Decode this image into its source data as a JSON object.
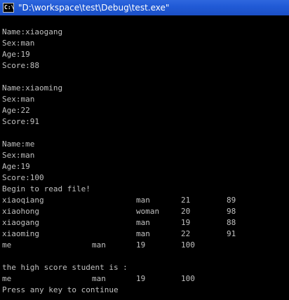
{
  "window": {
    "title": "\"D:\\workspace\\test\\Debug\\test.exe\"",
    "icon_label": "C:\\"
  },
  "console": {
    "students": [
      {
        "name": "Name:xiaogang",
        "sex": "Sex:man",
        "age": "Age:19",
        "score": "Score:88"
      },
      {
        "name": "Name:xiaoming",
        "sex": "Sex:man",
        "age": "Age:22",
        "score": "Score:91"
      },
      {
        "name": "Name:me",
        "sex": "Sex:man",
        "age": "Age:19",
        "score": "Score:100"
      }
    ],
    "begin_read": "Begin to read file!",
    "file_rows": [
      [
        "xiaoqiang",
        "man",
        "21",
        "89"
      ],
      [
        "xiaohong",
        "woman",
        "20",
        "98"
      ],
      [
        "xiaogang",
        "man",
        "19",
        "88"
      ],
      [
        "xiaoming",
        "man",
        "22",
        "91"
      ]
    ],
    "short_row": [
      "me",
      "man",
      "19",
      "100"
    ],
    "high_score_label": "the high score student is :",
    "high_score_row": [
      "me",
      "man",
      "19",
      "100"
    ],
    "continue_prompt": "Press any key to continue"
  }
}
